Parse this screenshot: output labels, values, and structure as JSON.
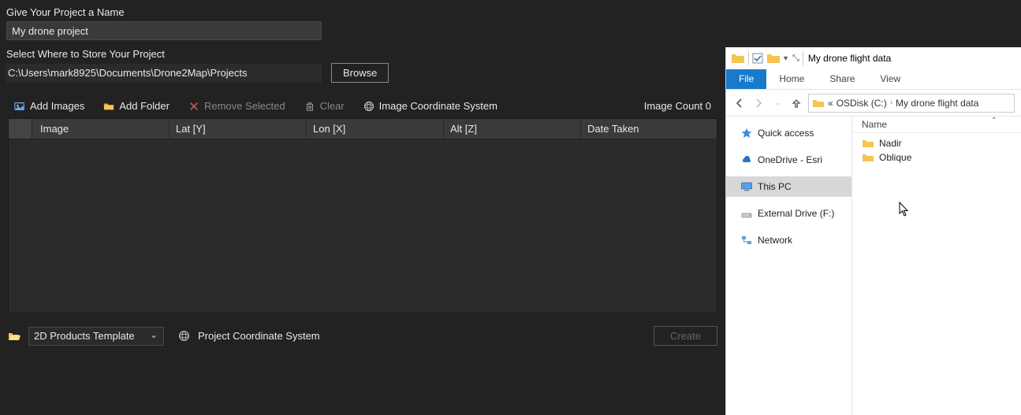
{
  "project_name_label": "Give Your Project a Name",
  "project_name_value": "My drone project",
  "store_label": "Select Where to Store Your Project",
  "store_path": "C:\\Users\\mark8925\\Documents\\Drone2Map\\Projects",
  "browse_label": "Browse",
  "toolbar": {
    "add_images": "Add Images",
    "add_folder": "Add Folder",
    "remove_selected": "Remove Selected",
    "clear": "Clear",
    "image_cs": "Image Coordinate System",
    "image_count_label": "Image Count 0"
  },
  "table_headers": {
    "image": "Image",
    "lat": "Lat [Y]",
    "lon": "Lon [X]",
    "alt": "Alt [Z]",
    "date": "Date Taken"
  },
  "template_value": "2D Products Template",
  "proj_cs_label": "Project Coordinate System",
  "create_label": "Create",
  "explorer": {
    "title": "My drone flight data",
    "tabs": {
      "file": "File",
      "home": "Home",
      "share": "Share",
      "view": "View"
    },
    "crumbs": {
      "sep": "«",
      "disk": "OSDisk (C:)",
      "folder": "My drone flight data"
    },
    "nav": {
      "quick": "Quick access",
      "onedrive": "OneDrive - Esri",
      "thispc": "This PC",
      "external": "External Drive (F:)",
      "network": "Network"
    },
    "col_name": "Name",
    "items": {
      "nadir": "Nadir",
      "oblique": "Oblique"
    }
  }
}
